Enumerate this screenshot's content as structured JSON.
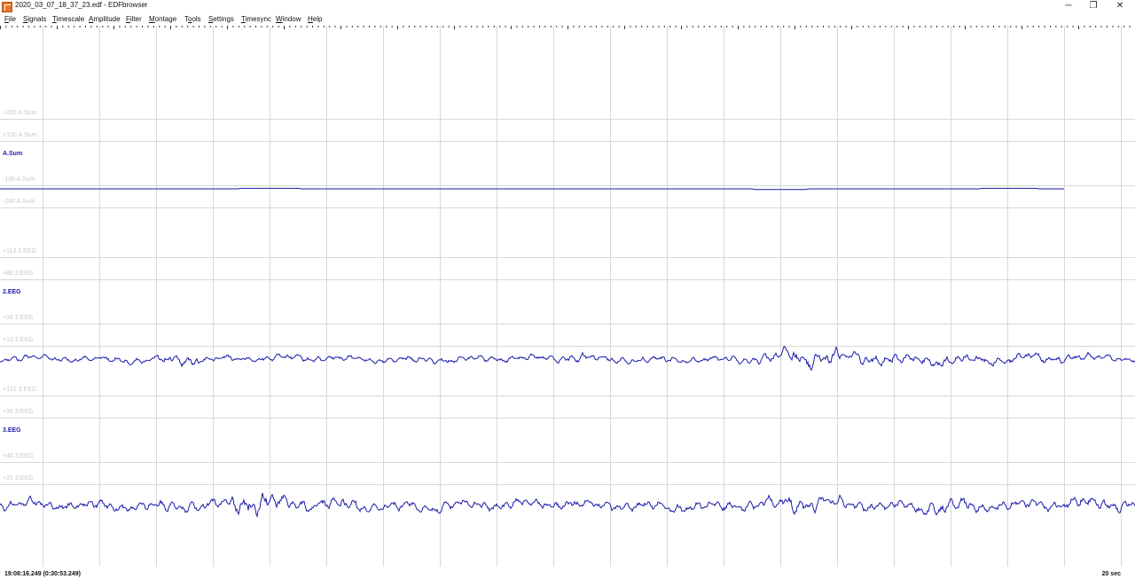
{
  "window": {
    "title": "2020_03_07_18_37_23.edf - EDFbrowser",
    "minimize_glyph": "─",
    "restore_glyph": "❐",
    "close_glyph": "✕"
  },
  "menu": [
    {
      "label": "File",
      "underline": "F",
      "rest": "ile"
    },
    {
      "label": "Signals",
      "underline": "S",
      "rest": "ignals"
    },
    {
      "label": "Timescale",
      "underline": "T",
      "rest": "imescale"
    },
    {
      "label": "Amplitude",
      "underline": "A",
      "rest": "mplitude"
    },
    {
      "label": "Filter",
      "underline": "F",
      "rest": "ilter"
    },
    {
      "label": "Montage",
      "underline": "M",
      "rest": "ontage"
    },
    {
      "label": "Tools",
      "pre": "T",
      "underline": "o",
      "rest": "ols"
    },
    {
      "label": "Settings",
      "underline": "S",
      "rest": "ettings"
    },
    {
      "label": "Timesync",
      "underline": "T",
      "rest": "imesync"
    },
    {
      "label": "Window",
      "underline": "W",
      "rest": "indow"
    },
    {
      "label": "Help",
      "underline": "H",
      "rest": "elp"
    }
  ],
  "signals": [
    {
      "name": "A.Sum",
      "color": "#1a1aa8",
      "amplitude_labels": [
        "+200 A.Sum",
        "+100 A.Sum",
        "-100 A.Sum",
        "-200 A.Sum"
      ]
    },
    {
      "name": "2.EEG",
      "color": "#1a1aa8",
      "amplitude_labels": [
        "+113 2.EEG",
        "+88 2.EEG",
        "+38 2.EEG",
        "+13 2.EEG"
      ]
    },
    {
      "name": "3.EEG",
      "color": "#1a1aa8",
      "amplitude_labels": [
        "+121 3.EEG",
        "+96 3.EEG",
        "+46 3.EEG",
        "+21 3.EEG"
      ]
    }
  ],
  "status": {
    "time": "19:08:16.249 (0:30:53.249)",
    "timescale": "20 sec"
  },
  "colors": {
    "trace": "#1a1aa8",
    "grid": "#d8d8d8",
    "ruler": "#333333",
    "label": "#1a1aa8",
    "amp_label": "#c8c8c8"
  }
}
